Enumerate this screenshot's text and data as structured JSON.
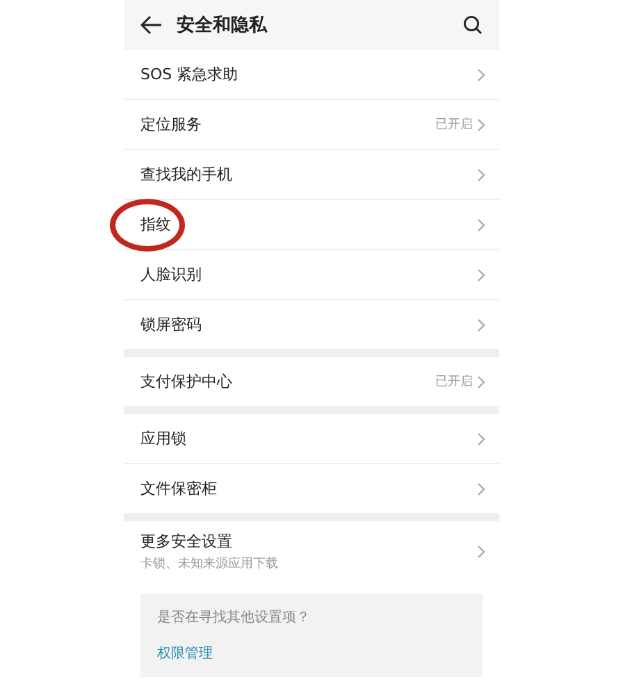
{
  "header": {
    "title": "安全和隐私"
  },
  "groups": [
    {
      "items": [
        {
          "label": "SOS 紧急求助",
          "circled": false
        },
        {
          "label": "定位服务",
          "value": "已开启",
          "circled": false
        },
        {
          "label": "查找我的手机",
          "circled": false
        },
        {
          "label": "指纹",
          "circled": true
        },
        {
          "label": "人脸识别",
          "circled": false
        },
        {
          "label": "锁屏密码",
          "circled": false
        }
      ]
    },
    {
      "items": [
        {
          "label": "支付保护中心",
          "value": "已开启",
          "circled": false
        }
      ]
    },
    {
      "items": [
        {
          "label": "应用锁",
          "circled": false
        },
        {
          "label": "文件保密柜",
          "circled": false
        }
      ]
    },
    {
      "items": [
        {
          "label": "更多安全设置",
          "subtitle": "卡锁、未知来源应用下载",
          "circled": false
        }
      ]
    }
  ],
  "tip": {
    "question": "是否在寻找其他设置项？",
    "link": "权限管理"
  }
}
